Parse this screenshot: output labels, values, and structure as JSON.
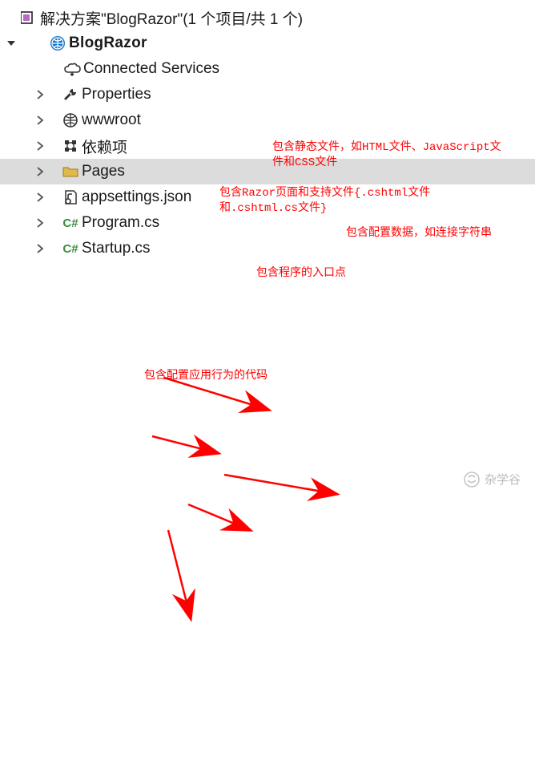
{
  "solution": {
    "label": "解决方案\"BlogRazor\"(1 个项目/共 1 个)",
    "project": "BlogRazor"
  },
  "nodes": {
    "connected_services": "Connected Services",
    "properties": "Properties",
    "wwwroot": "wwwroot",
    "deps": "依赖项",
    "pages": "Pages",
    "appsettings": "appsettings.json",
    "program": "Program.cs",
    "startup": "Startup.cs"
  },
  "annotations": {
    "wwwroot": "包含静态文件，如HTML文件、JavaScript文\n件和CSS文件",
    "pages": "包含Razor页面和支持文件{.cshtml文件\n和.cshtml.cs文件}",
    "appsettings": "包含配置数据，如连接字符串",
    "program": "包含程序的入口点",
    "startup": "包含配置应用行为的代码"
  },
  "watermark": "杂学谷"
}
